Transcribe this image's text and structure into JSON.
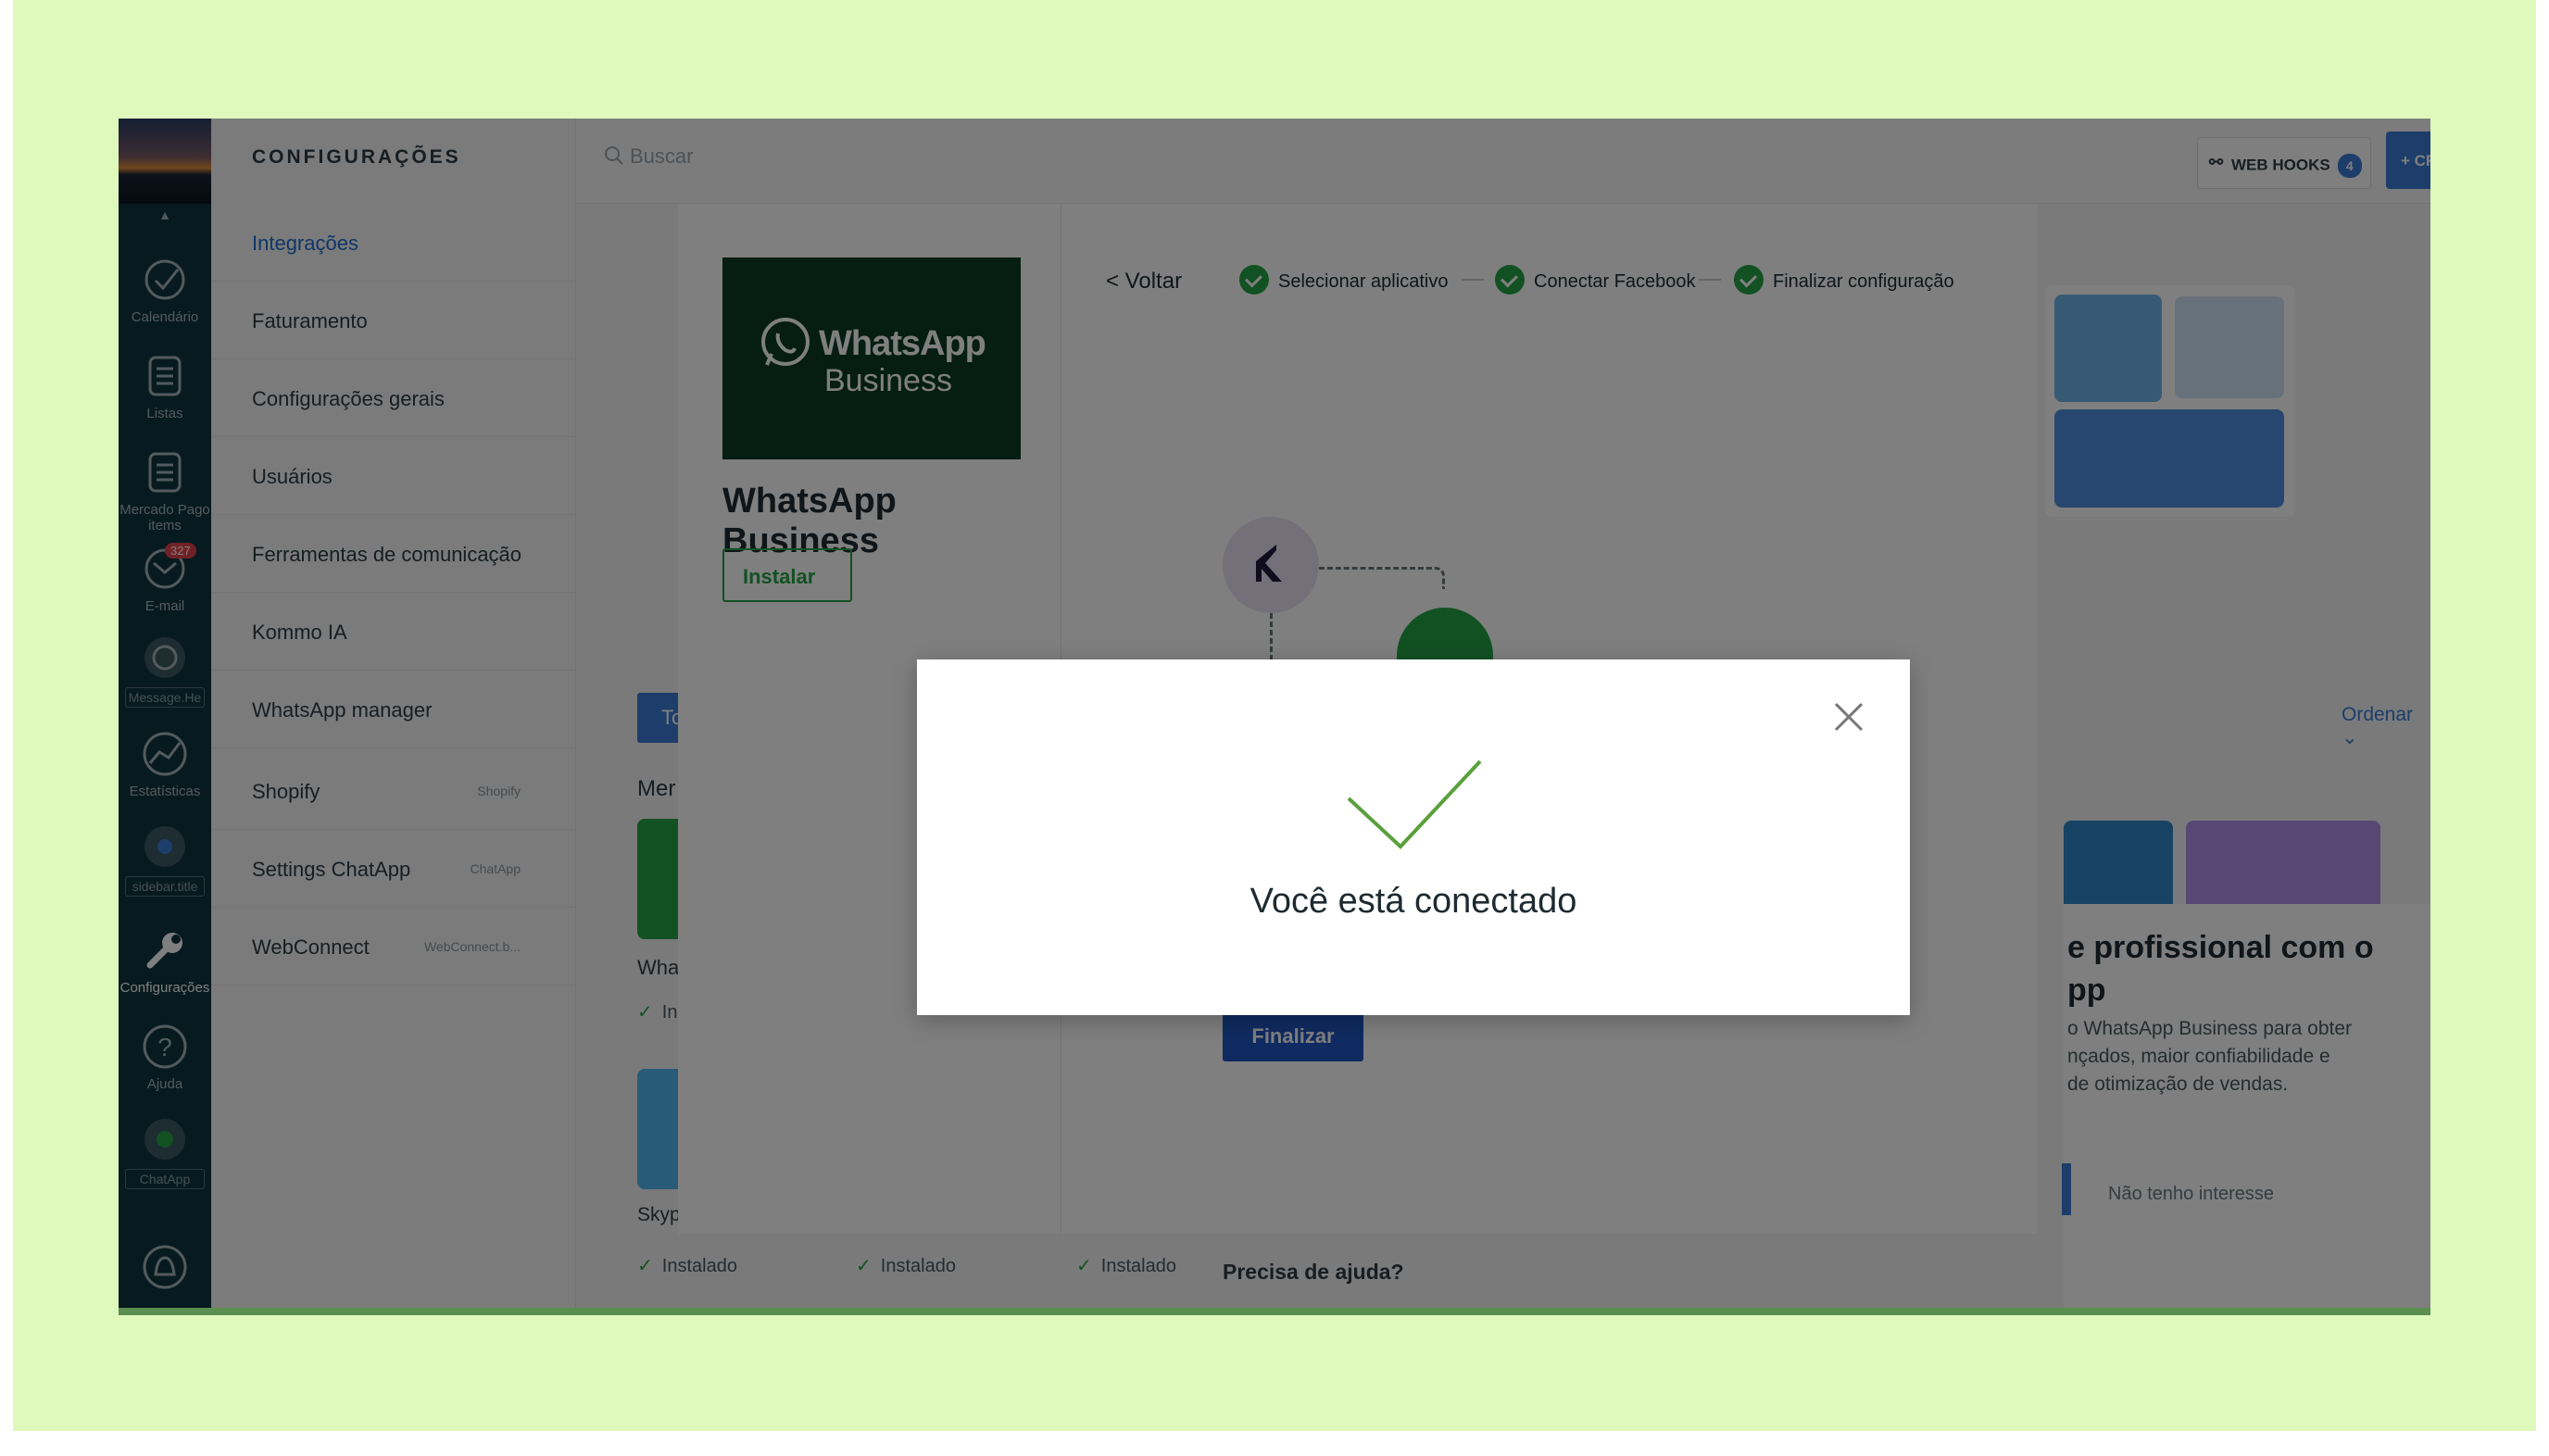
{
  "sidebar": {
    "items": [
      {
        "label": "Calendário"
      },
      {
        "label": "Listas"
      },
      {
        "label": "Mercado Pago items"
      },
      {
        "label": "E-mail",
        "badge": "327"
      },
      {
        "label": "Message.He"
      },
      {
        "label": "Estatísticas"
      },
      {
        "label": "sidebar.title"
      },
      {
        "label": "Configurações"
      },
      {
        "label": "Ajuda"
      },
      {
        "label": "ChatApp"
      }
    ]
  },
  "settings": {
    "title": "CONFIGURAÇÕES",
    "items": [
      {
        "label": "Integrações",
        "tag": ""
      },
      {
        "label": "Faturamento",
        "tag": ""
      },
      {
        "label": "Configurações gerais",
        "tag": ""
      },
      {
        "label": "Usuários",
        "tag": ""
      },
      {
        "label": "Ferramentas de comunicação",
        "tag": ""
      },
      {
        "label": "Kommo IA",
        "tag": ""
      },
      {
        "label": "WhatsApp manager",
        "tag": ""
      },
      {
        "label": "Shopify",
        "tag": "Shopify"
      },
      {
        "label": "Settings ChatApp",
        "tag": "ChatApp"
      },
      {
        "label": "WebConnect",
        "tag": "WebConnect.b..."
      }
    ]
  },
  "topbar": {
    "search_placeholder": "Buscar",
    "webhooks_label": "WEB HOOKS",
    "webhooks_count": "4",
    "create_label": "+ CRIAR INTEGRAÇ"
  },
  "background": {
    "sort_label": "Ordenar",
    "promo_title": "e profissional com o\npp",
    "promo_text": "o WhatsApp Business para obter\nnçados, maior confiabilidade e\nde otimização de vendas.",
    "no_interest": "Não tenho interesse",
    "tab_letter": "To",
    "section_label": "Mer",
    "card_name_1": "Wha",
    "card_name_2": "Skyp",
    "installed_partial": "In",
    "installed": "Instalado"
  },
  "integration_modal": {
    "logo_line1": "WhatsApp",
    "logo_line2": "Business",
    "title": "WhatsApp Business",
    "install_button": "Instalar",
    "back": "< Voltar",
    "steps": [
      "Selecionar aplicativo",
      "Conectar Facebook",
      "Finalizar configuração"
    ],
    "finish_button": "Finalizar",
    "help": "Precisa de ajuda?"
  },
  "success_dialog": {
    "message": "Você está conectado"
  },
  "colors": {
    "accent_green": "#25a244",
    "accent_blue": "#3a7bd5",
    "nav_bg": "#0e3440",
    "frame_bg": "#dff9bd"
  }
}
